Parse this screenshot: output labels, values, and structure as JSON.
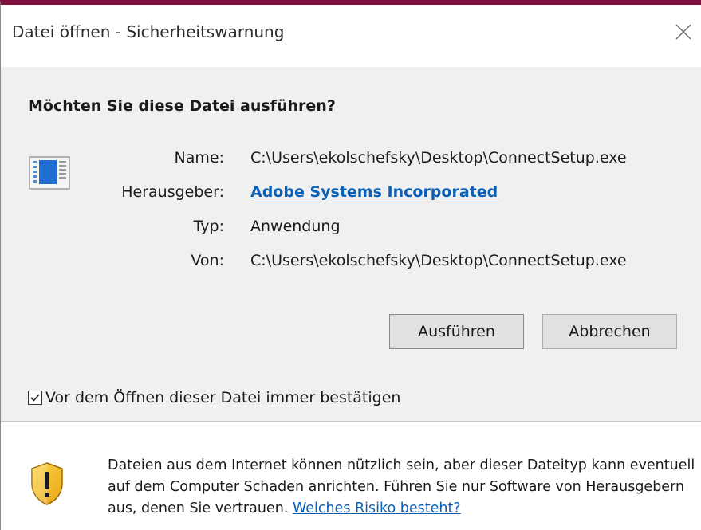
{
  "window": {
    "title": "Datei öffnen - Sicherheitswarnung",
    "accent_color": "#7a0f3c"
  },
  "dialog": {
    "question": "Möchten Sie diese Datei ausführen?",
    "fields": {
      "name_label": "Name:",
      "name_value": "C:\\Users\\ekolschefsky\\Desktop\\ConnectSetup.exe",
      "publisher_label": "Herausgeber:",
      "publisher_value": "Adobe Systems Incorporated",
      "type_label": "Typ:",
      "type_value": "Anwendung",
      "from_label": "Von:",
      "from_value": "C:\\Users\\ekolschefsky\\Desktop\\ConnectSetup.exe"
    },
    "buttons": {
      "run": "Ausführen",
      "cancel": "Abbrechen"
    },
    "checkbox": {
      "label": "Vor dem Öffnen dieser Datei immer bestätigen",
      "checked": true
    }
  },
  "footer": {
    "warning_text": "Dateien aus dem Internet können nützlich sein, aber dieser Dateityp kann eventuell auf dem Computer Schaden anrichten. Führen Sie nur Software von Herausgebern aus, denen Sie vertrauen.",
    "risk_link": "Welches Risiko besteht?"
  },
  "icons": {
    "file": "application-file-icon",
    "shield": "warning-shield-icon",
    "close": "close-icon",
    "check": "checkmark-icon"
  }
}
